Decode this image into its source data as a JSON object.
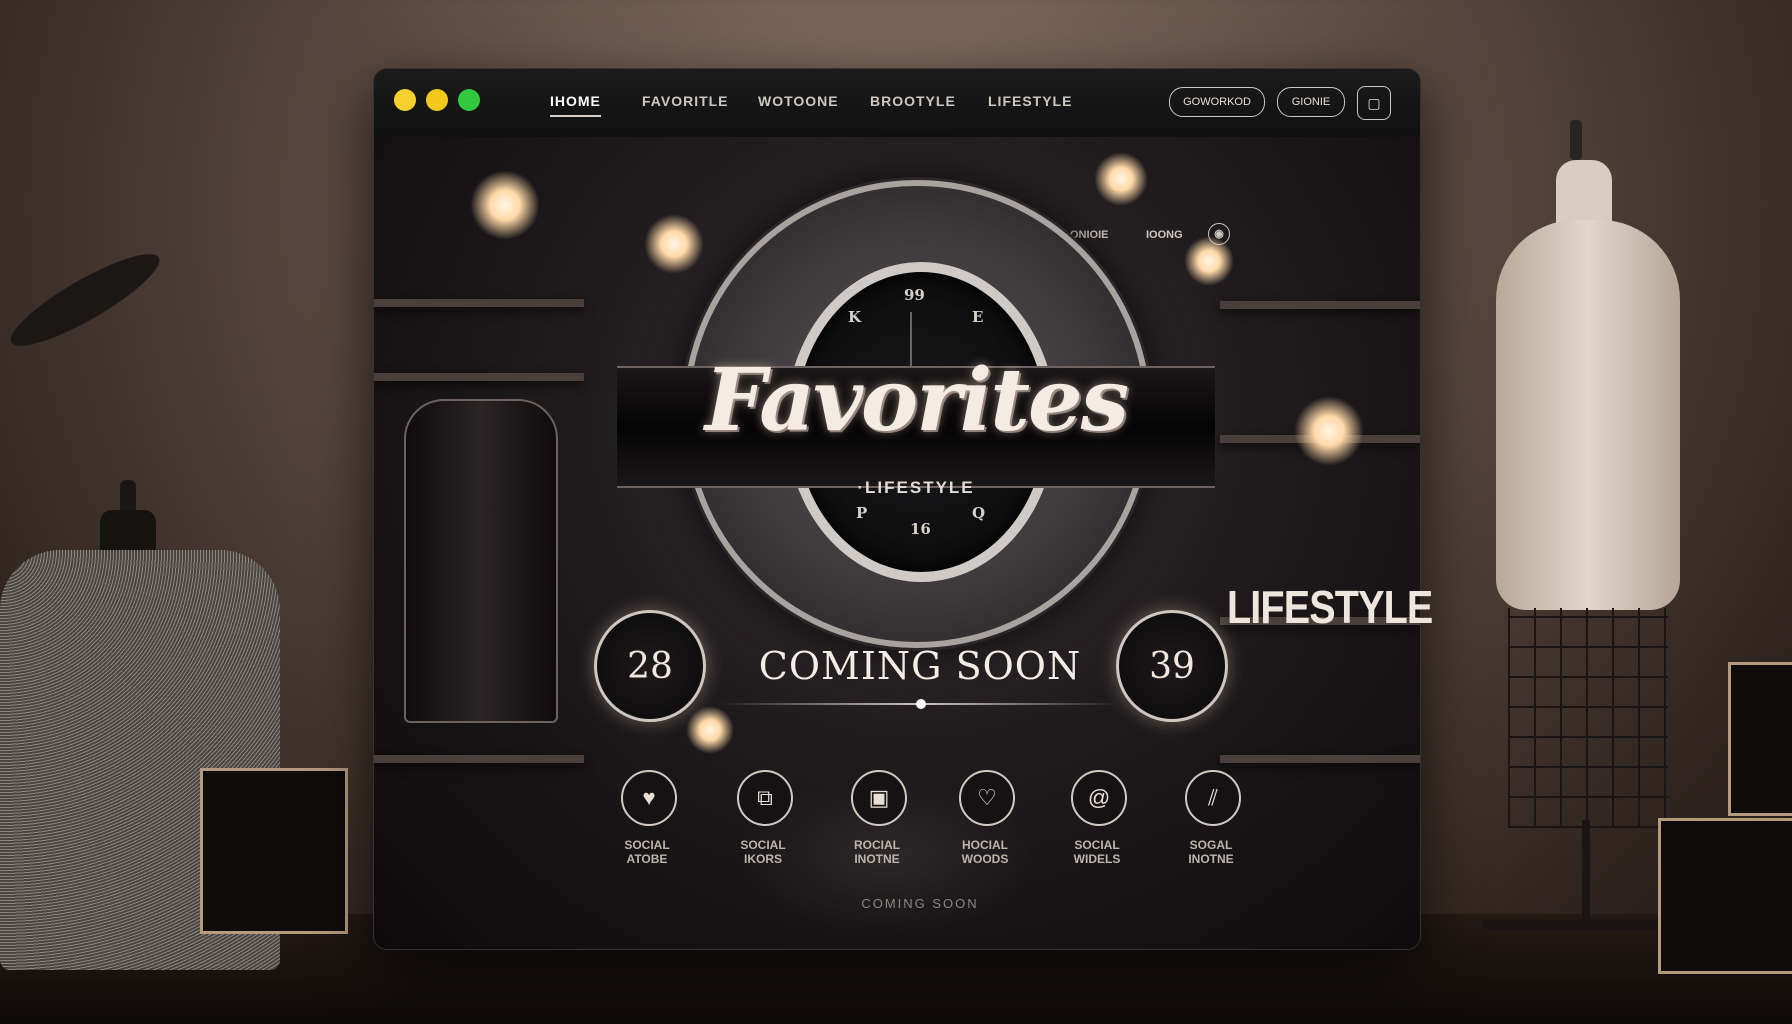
{
  "window_controls": {
    "colors": [
      "#f6d02e",
      "#f2c81b",
      "#33c83e"
    ]
  },
  "nav": {
    "items": [
      "IHOME",
      "FAVORITLE",
      "WOTOONE",
      "BROOTYLE",
      "LIFESTYLE"
    ],
    "active": "IHOME"
  },
  "header_buttons": {
    "left": "GOWORKOD",
    "right": "GIONIE"
  },
  "sub_nav": {
    "items": [
      "ONIOIE",
      "IOONG"
    ]
  },
  "hero": {
    "title": "Favorites",
    "subtitle": "·LIFESTYLE",
    "clock_marks": [
      "99",
      "K",
      "E",
      "P",
      "Q",
      "16"
    ]
  },
  "countdown": {
    "left": "28",
    "right": "39",
    "label": "COMING SOON"
  },
  "side_label": "LIFESTYLE",
  "social": [
    {
      "icon": "heart-icon",
      "glyph": "♥",
      "label": "SOCIAL",
      "sub": "ATOBE"
    },
    {
      "icon": "chat-icon",
      "glyph": "⧉",
      "label": "SOCIAL",
      "sub": "IKORS"
    },
    {
      "icon": "gallery-icon",
      "glyph": "▣",
      "label": "ROCIAL",
      "sub": "INOTNE"
    },
    {
      "icon": "heart-badge-icon",
      "glyph": "♡",
      "label": "HOCIAL",
      "sub": "WOODS"
    },
    {
      "icon": "at-icon",
      "glyph": "@",
      "label": "SOCIAL",
      "sub": "WIDELS"
    },
    {
      "icon": "bags-icon",
      "glyph": "⫽",
      "label": "SOGAL",
      "sub": "INOTNE"
    }
  ],
  "footer": "COMING SOON"
}
